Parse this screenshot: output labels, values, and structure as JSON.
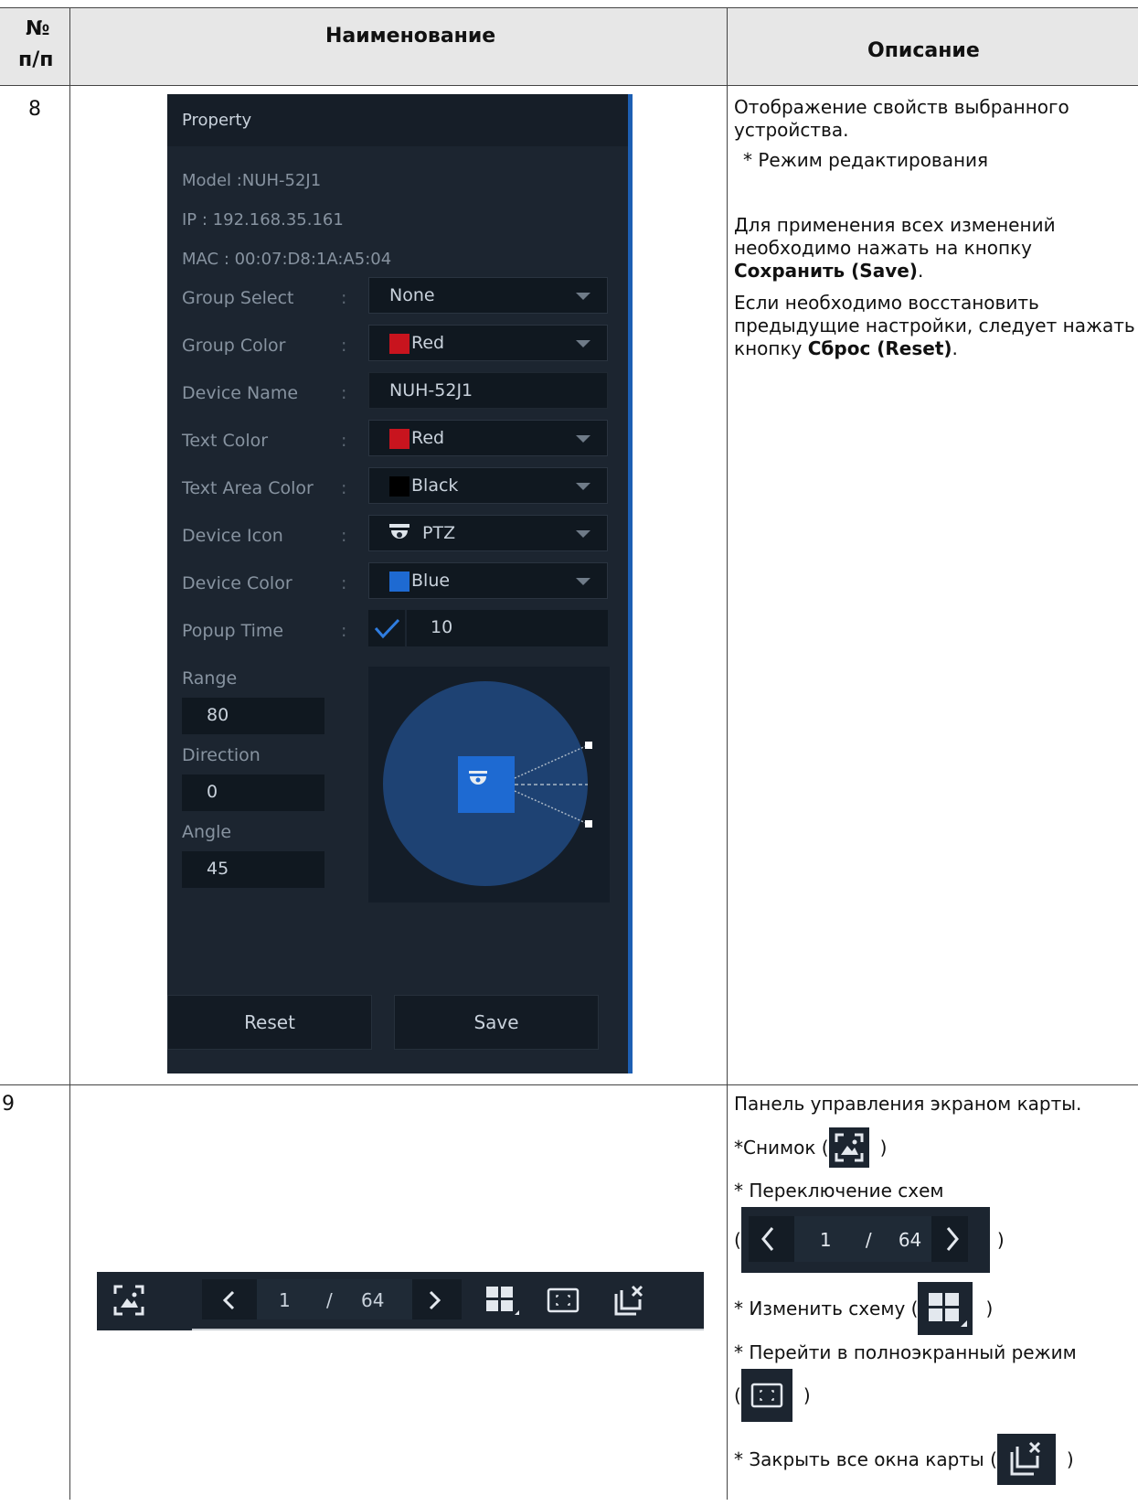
{
  "header": {
    "col_num": "№ п/п",
    "col_num_line1": "№",
    "col_num_line2": "п/п",
    "col_name": "Наименование",
    "col_desc": "Описание"
  },
  "rows": [
    {
      "number": "8",
      "panel": {
        "title": "Property",
        "model": "Model :NUH-52J1",
        "ip": "IP : 192.168.35.161",
        "mac": "MAC : 00:07:D8:1A:A5:04",
        "fields": [
          {
            "label": "Group Select",
            "value": "None",
            "swatch": "",
            "dropdown": true
          },
          {
            "label": "Group Color",
            "value": "Red",
            "swatch": "#c8141e",
            "dropdown": true
          },
          {
            "label": "Device Name",
            "value": "NUH-52J1",
            "swatch": "",
            "dropdown": false
          },
          {
            "label": "Text Color",
            "value": "Red",
            "swatch": "#c8141e",
            "dropdown": true
          },
          {
            "label": "Text Area Color",
            "value": "Black",
            "swatch": "#000000",
            "dropdown": true
          },
          {
            "label": "Device Icon",
            "value": "PTZ",
            "swatch": "ptz-icon",
            "dropdown": true
          },
          {
            "label": "Device Color",
            "value": "Blue",
            "swatch": "#1e6ad2",
            "dropdown": true
          },
          {
            "label": "Popup Time",
            "value": "10",
            "swatch": "checkbox",
            "dropdown": false
          }
        ],
        "colon": ":",
        "range_label": "Range",
        "range_value": "80",
        "direction_label": "Direction",
        "direction_value": "0",
        "angle_label": "Angle",
        "angle_value": "45",
        "reset_label": "Reset",
        "save_label": "Save"
      },
      "desc": {
        "p1": "Отображение свойств выбранного устройства.",
        "p2": "* Режим редактирования",
        "p3_a": "Для применения всех изменений необходимо нажать на кнопку ",
        "p3_b": "Сохранить (Save)",
        "p3_c": ".",
        "p4_a": "Если необходимо восстановить предыдущие настройки, следует нажать кнопку ",
        "p4_b": "Сброс (Reset)",
        "p4_c": "."
      }
    },
    {
      "number": "9",
      "toolbar": {
        "page_current": "1",
        "page_sep": "/",
        "page_total": "64"
      },
      "desc": {
        "p1": "Панель управления экраном карты.",
        "p2": "*Снимок (",
        "p2_end": ")",
        "p3": "* Переключение схем",
        "p4_open": "(",
        "p4_close": ")",
        "p5": "* Изменить схему (",
        "p5_end": ")",
        "p6": "* Перейти в полноэкранный режим",
        "p7_open": "(",
        "p7_close": ")",
        "p8": "* Закрыть все окна карты (",
        "p8_end": ")"
      }
    }
  ],
  "colors": {
    "panel_bg": "#1c2530",
    "accent_blue": "#1e6ad2",
    "header_bg": "#e7e7e7"
  }
}
